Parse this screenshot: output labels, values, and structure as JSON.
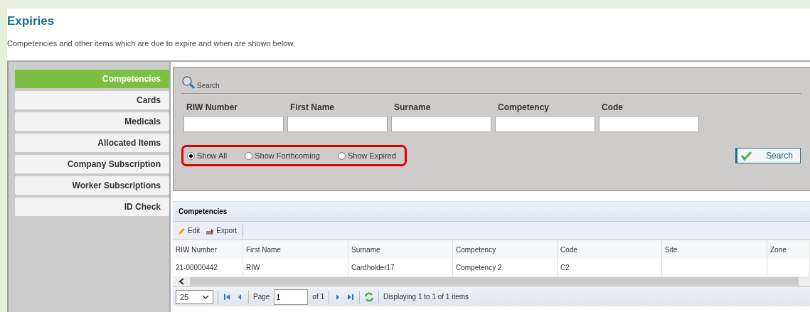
{
  "page": {
    "title": "Expiries",
    "description": "Competencies and other items which are due to expire and when are shown below."
  },
  "sidebar": {
    "items": [
      {
        "label": "Competencies",
        "selected": true
      },
      {
        "label": "Cards",
        "selected": false
      },
      {
        "label": "Medicals",
        "selected": false
      },
      {
        "label": "Allocated Items",
        "selected": false
      },
      {
        "label": "Company Subscription",
        "selected": false
      },
      {
        "label": "Worker Subscriptions",
        "selected": false
      },
      {
        "label": "ID Check",
        "selected": false
      }
    ]
  },
  "search_panel": {
    "heading": "Search",
    "fields": [
      {
        "label": "RIW Number"
      },
      {
        "label": "First Name"
      },
      {
        "label": "Surname"
      },
      {
        "label": "Competency"
      },
      {
        "label": "Code"
      }
    ],
    "filters": [
      {
        "label": "Show All",
        "selected": true
      },
      {
        "label": "Show Forthcoming",
        "selected": false
      },
      {
        "label": "Show Expired",
        "selected": false
      }
    ],
    "button": "Search"
  },
  "grid": {
    "title": "Competencies",
    "toolbar": [
      "Edit",
      "Export"
    ],
    "columns": [
      "RIW Number",
      "First Name",
      "Surname",
      "Competency",
      "Code",
      "Site",
      "Zone"
    ],
    "rows": [
      [
        "21-00000442",
        "RIW",
        "Cardholder17",
        "Competency 2",
        "C2",
        "",
        ""
      ]
    ],
    "pager": {
      "page_size": "25",
      "page_label": "Page",
      "page": "1",
      "of": "of 1",
      "summary": "Displaying 1 to 1 of 1 items"
    }
  }
}
